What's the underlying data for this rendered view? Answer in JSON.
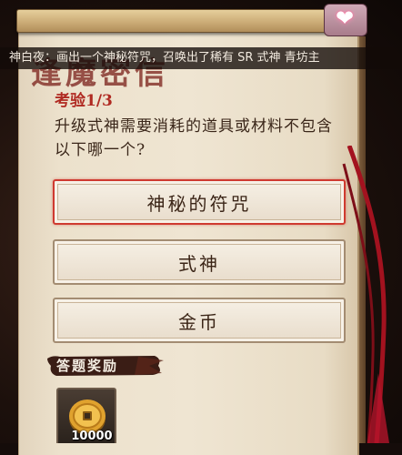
{
  "notice": {
    "text": "神白夜：画出一个神秘符咒，召唤出了稀有 SR 式神 青坊主"
  },
  "header": {
    "title_partial": "逢魔密信"
  },
  "quiz": {
    "progress": "考验1/3",
    "question": "升级式神需要消耗的道具或材料不包含以下哪一个?",
    "options": [
      {
        "label": "神秘的符咒",
        "selected": true
      },
      {
        "label": "式神",
        "selected": false
      },
      {
        "label": "金币",
        "selected": false
      }
    ]
  },
  "reward": {
    "title": "答题奖励",
    "item_icon": "gold-coin-icon",
    "quantity": "10000"
  },
  "colors": {
    "accent_red": "#cf3a30",
    "parchment": "#efe5d2",
    "text_dark": "#3b2517"
  }
}
